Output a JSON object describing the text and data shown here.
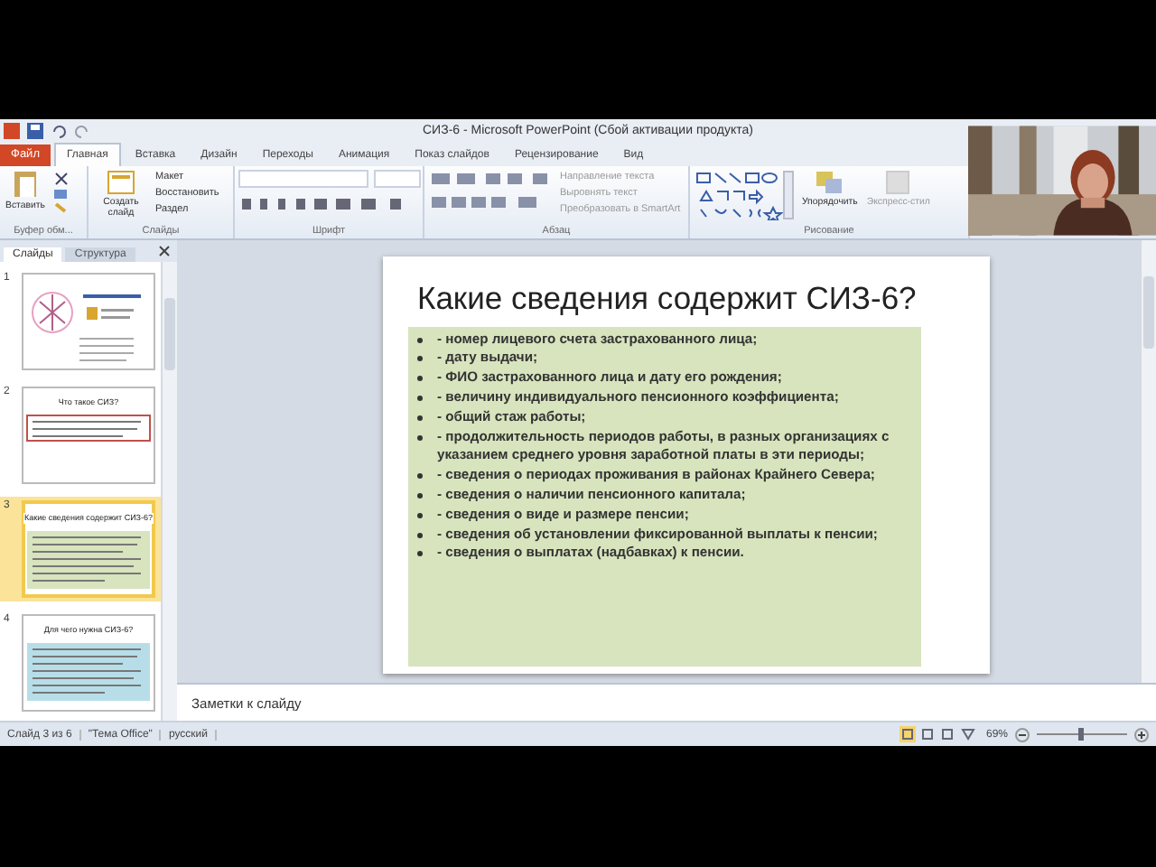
{
  "window": {
    "title": "СИЗ-6 - Microsoft PowerPoint (Сбой активации продукта)"
  },
  "tabs": [
    {
      "label": "Файл",
      "kind": "file",
      "selected": false
    },
    {
      "label": "Главная",
      "kind": "tab",
      "selected": true
    },
    {
      "label": "Вставка",
      "kind": "tab",
      "selected": false
    },
    {
      "label": "Дизайн",
      "kind": "tab",
      "selected": false
    },
    {
      "label": "Переходы",
      "kind": "tab",
      "selected": false
    },
    {
      "label": "Анимация",
      "kind": "tab",
      "selected": false
    },
    {
      "label": "Показ слайдов",
      "kind": "tab",
      "selected": false
    },
    {
      "label": "Рецензирование",
      "kind": "tab",
      "selected": false
    },
    {
      "label": "Вид",
      "kind": "tab",
      "selected": false
    }
  ],
  "ribbon": [
    {
      "kind": "clipboard",
      "label": "Буфер обм...",
      "items": [
        "Вставить"
      ]
    },
    {
      "kind": "slides",
      "label": "Слайды",
      "items": [
        "Создать слайд",
        "Макет",
        "Восстановить",
        "Раздел"
      ]
    },
    {
      "kind": "font",
      "label": "Шрифт"
    },
    {
      "kind": "paragraph",
      "label": "Абзац",
      "items": [
        "Направление текста",
        "Выровнять текст",
        "Преобразовать в SmartArt"
      ]
    },
    {
      "kind": "drawing",
      "label": "Рисование",
      "items": [
        "Упорядочить",
        "Экспресс-стил"
      ]
    }
  ],
  "pane_tabs": [
    {
      "label": "Слайды",
      "selected": true
    },
    {
      "label": "Структура",
      "selected": false
    }
  ],
  "thumbnails": [
    {
      "number": "1",
      "kind": "cover",
      "selected": false
    },
    {
      "number": "2",
      "kind": "text",
      "title": "Что такое СИЗ?",
      "color": "#c0504d",
      "selected": false
    },
    {
      "number": "3",
      "kind": "text",
      "title": "Какие сведения содержит СИЗ-6?",
      "color": "#d7e4bd",
      "selected": true
    },
    {
      "number": "4",
      "kind": "text",
      "title": "Для чего нужна СИЗ-6?",
      "color": "#b7dee8",
      "selected": false
    }
  ],
  "slide": {
    "title": "Какие сведения содержит СИЗ-6?",
    "bullets": [
      "- номер лицевого счета застрахованного лица;",
      "- дату выдачи;",
      "- ФИО застрахованного лица и дату его рождения;",
      "- величину индивидуального пенсионного коэффициента;",
      "- общий стаж работы;",
      "- продолжительность периодов работы, в разных организациях с указанием среднего уровня заработной платы в эти периоды;",
      "- сведения о периодах проживания в районах Крайнего Севера;",
      "-  сведения о наличии пенсионного капитала;",
      "- сведения о виде и размере пенсии;",
      "- сведения об установлении фиксированной выплаты к пенсии;",
      "- сведения о выплатах (надбавках) к пенсии."
    ]
  },
  "notes": {
    "placeholder": "Заметки к слайду"
  },
  "status_bar": {
    "slide": "Слайд 3 из 6",
    "theme": "\"Тема Office\"",
    "language": "русский",
    "zoom": "69%",
    "level": 0.45
  }
}
